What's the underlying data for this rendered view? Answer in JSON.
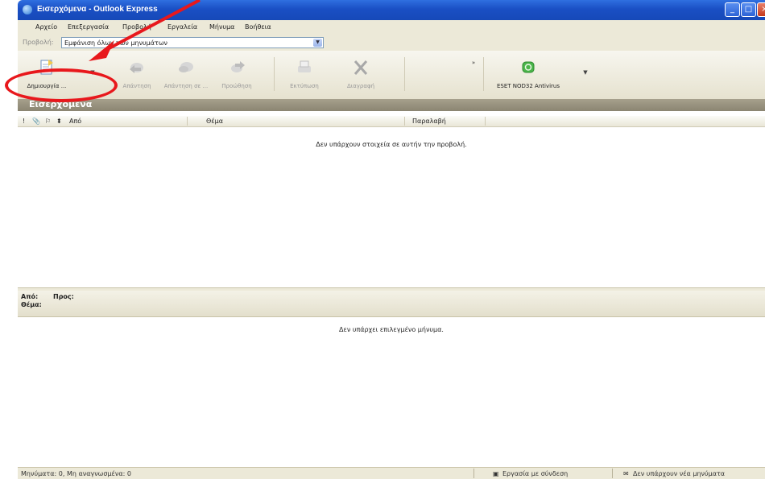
{
  "window": {
    "title": "Εισερχόμενα - Outlook Express",
    "buttons": [
      "minimize",
      "maximize",
      "close"
    ]
  },
  "menu": {
    "items": [
      "Αρχείο",
      "Επεξεργασία",
      "Προβολή",
      "Εργαλεία",
      "Μήνυμα",
      "Βοήθεια"
    ]
  },
  "viewbar": {
    "label": "Προβολή:",
    "selected": "Εμφάνιση όλων των μηνυμάτων"
  },
  "toolbar": {
    "buttons": [
      {
        "label": "Δημιουργία ...",
        "icon": "new-mail-icon",
        "enabled": true
      },
      {
        "label": "Απάντηση",
        "icon": "reply-icon",
        "enabled": false
      },
      {
        "label": "Απάντηση σε ...",
        "icon": "reply-all-icon",
        "enabled": false
      },
      {
        "label": "Προώθηση",
        "icon": "forward-icon",
        "enabled": false
      },
      {
        "label": "Εκτύπωση",
        "icon": "print-icon",
        "enabled": false
      },
      {
        "label": "Διαγραφή",
        "icon": "delete-icon",
        "enabled": false
      },
      {
        "label": "ESET NOD32 Antivirus",
        "icon": "eset-icon",
        "enabled": true
      }
    ]
  },
  "folder": {
    "title": "Εισερχόμενα"
  },
  "columns": {
    "icons": [
      "!",
      "📎",
      "⚐",
      "⬍"
    ],
    "from": "Από",
    "subject": "Θέμα",
    "received": "Παραλαβή"
  },
  "message_list": {
    "empty_text": "Δεν υπάρχουν στοιχεία σε αυτήν την προβολή."
  },
  "preview": {
    "from_label": "Από:",
    "to_label": "Προς:",
    "subject_label": "Θέμα:",
    "empty_text": "Δεν υπάρχει επιλεγμένο μήνυμα."
  },
  "status": {
    "counts": "Μηνύματα: 0, Μη αναγνωσμένα: 0",
    "online": "Εργασία με σύνδεση",
    "new_mail": "Δεν υπάρχουν νέα μηνύματα"
  },
  "colors": {
    "annotation": "#e8181c",
    "titlebar": "#1a4fc4"
  }
}
